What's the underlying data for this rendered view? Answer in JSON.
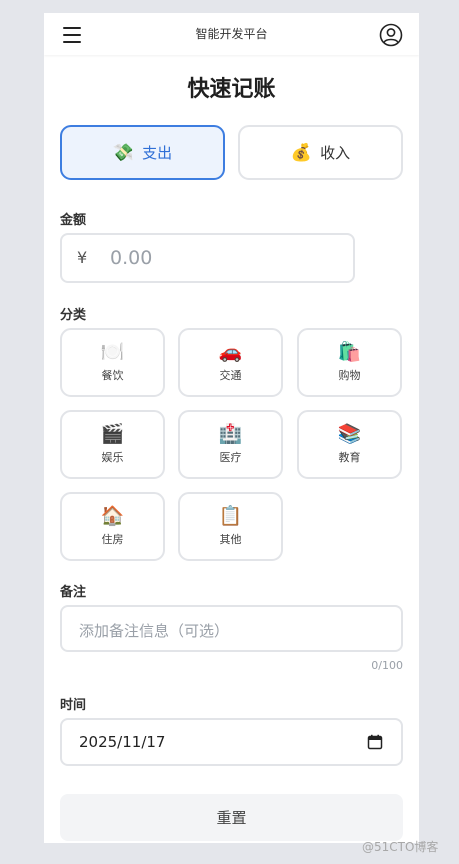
{
  "header": {
    "app_title": "智能开发平台",
    "menu_icon": "hamburger-menu-icon",
    "user_icon": "user-circle-icon"
  },
  "page": {
    "title": "快速记账"
  },
  "type_toggle": {
    "expense": {
      "emoji": "💸",
      "label": "支出",
      "active": true
    },
    "income": {
      "emoji": "💰",
      "label": "收入",
      "active": false
    }
  },
  "amount": {
    "label": "金额",
    "currency": "¥",
    "placeholder": "0.00"
  },
  "category": {
    "label": "分类",
    "items": [
      {
        "emoji": "🍽️",
        "label": "餐饮"
      },
      {
        "emoji": "🚗",
        "label": "交通"
      },
      {
        "emoji": "🛍️",
        "label": "购物"
      },
      {
        "emoji": "🎬",
        "label": "娱乐"
      },
      {
        "emoji": "🏥",
        "label": "医疗"
      },
      {
        "emoji": "📚",
        "label": "教育"
      },
      {
        "emoji": "🏠",
        "label": "住房"
      },
      {
        "emoji": "📋",
        "label": "其他"
      }
    ]
  },
  "note": {
    "label": "备注",
    "placeholder": "添加备注信息（可选）",
    "counter": "0/100"
  },
  "date": {
    "label": "时间",
    "value": "2025/11/17",
    "icon": "calendar-icon"
  },
  "actions": {
    "reset_label": "重置"
  },
  "watermark": "@51CTO博客",
  "colors": {
    "accent": "#3d7de0",
    "active_bg": "#edf3fd",
    "border": "#e2e4e8",
    "page_bg": "#e4e6eb"
  }
}
